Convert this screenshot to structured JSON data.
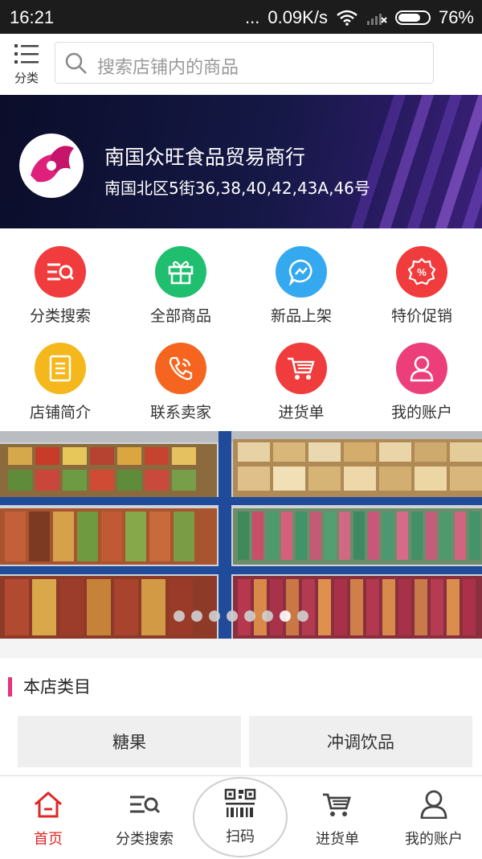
{
  "status_bar": {
    "time": "16:21",
    "dots": "...",
    "network_speed": "0.09K/s",
    "battery_percent_text": "76%",
    "battery_level": 0.76
  },
  "header": {
    "category_label": "分类",
    "search_placeholder": "搜索店铺内的商品"
  },
  "shop": {
    "name": "南国众旺食品贸易商行",
    "address": "南国北区5街36,38,40,42,43A,46号"
  },
  "shortcuts": [
    {
      "label": "分类搜索",
      "icon": "category-search-icon",
      "color": "#f03c3c"
    },
    {
      "label": "全部商品",
      "icon": "gift-icon",
      "color": "#1fbf6f"
    },
    {
      "label": "新品上架",
      "icon": "new-arrival-icon",
      "color": "#35a9f0"
    },
    {
      "label": "特价促销",
      "icon": "discount-icon",
      "color": "#f03c3c"
    },
    {
      "label": "店铺简介",
      "icon": "shop-profile-icon",
      "color": "#f5b81c"
    },
    {
      "label": "联系卖家",
      "icon": "phone-icon",
      "color": "#f5651f"
    },
    {
      "label": "进货单",
      "icon": "cart-icon",
      "color": "#f03c3c"
    },
    {
      "label": "我的账户",
      "icon": "user-icon",
      "color": "#ec3f7a"
    }
  ],
  "carousel": {
    "slide_count": 8,
    "active_index": 6
  },
  "categories": {
    "title": "本店类目",
    "items": [
      "糖果",
      "冲调饮品"
    ],
    "accent": "#e6337a"
  },
  "tabbar": [
    {
      "label": "首页",
      "icon": "home-icon",
      "active": true,
      "color": "#e02727"
    },
    {
      "label": "分类搜索",
      "icon": "category-search-icon"
    },
    {
      "label": "扫码",
      "icon": "qr-scan-icon"
    },
    {
      "label": "进货单",
      "icon": "cart-icon"
    },
    {
      "label": "我的账户",
      "icon": "user-icon"
    }
  ]
}
